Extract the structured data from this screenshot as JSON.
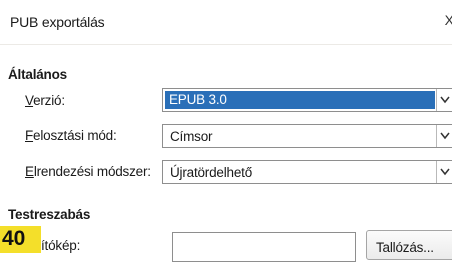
{
  "window": {
    "title": "PUB exportálás",
    "close_label": "X"
  },
  "general": {
    "heading": "Általános",
    "version": {
      "label_ul": "V",
      "label_rest": "erzió:",
      "value": "EPUB 3.0"
    },
    "split": {
      "label_ul": "F",
      "label_rest": "elosztási mód:",
      "value": "Címsor"
    },
    "layout": {
      "label_ul": "E",
      "label_rest": "lrendezési módszer:",
      "value": "Újratördelhető"
    }
  },
  "custom": {
    "heading": "Testreszabás",
    "cover": {
      "label": "ítókép:",
      "value": ""
    },
    "browse_button": "Tallózás..."
  },
  "page_number": "40"
}
